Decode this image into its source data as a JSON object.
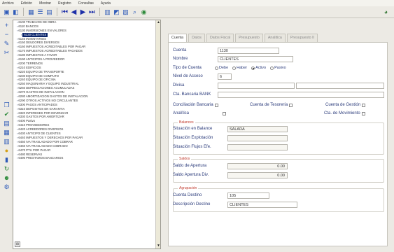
{
  "menu": [
    "Archivo",
    "Edición",
    "Mostrar",
    "Registro",
    "Consultas",
    "Ayuda"
  ],
  "toolbar": {
    "icons": [
      "open-icon",
      "save-icon",
      "grid-icon",
      "list-icon",
      "table-icon",
      "first-record-icon",
      "prev-record-icon",
      "next-record-icon",
      "last-record-icon",
      "print-icon",
      "filter-icon",
      "preview-icon",
      "search-icon",
      "refresh-icon"
    ],
    "help_icon": "help-icon"
  },
  "left_icons": [
    "add-icon",
    "delete-icon",
    "edit-icon",
    "cut-icon",
    "copy-icon",
    "check-icon",
    "notes-icon",
    "calendar-icon",
    "report-icon",
    "money-icon",
    "chart-icon",
    "refresh-icon",
    "user-icon",
    "settings-icon"
  ],
  "tree": {
    "items": [
      {
        "level": 0,
        "text": "6100 TRABAJOS DE OBRA"
      },
      {
        "level": 0,
        "text": "6110 BANCOS"
      },
      {
        "level": 0,
        "text": "6130 INVERSIONES EN VALORES"
      },
      {
        "level": 1,
        "text": "6130 CLIENTES",
        "selected": true
      },
      {
        "level": 0,
        "text": "6140 INVENTARIOS"
      },
      {
        "level": 0,
        "text": "6150 DEUDORES DIVERSOS"
      },
      {
        "level": 0,
        "text": "6160 IMPUESTOS ACREDITABLES POR PAGAR"
      },
      {
        "level": 0,
        "text": "6170 IMPUESTOS ACREDITABLES PAGADOS"
      },
      {
        "level": 0,
        "text": "6180 IMPUESTOS A FAVOR"
      },
      {
        "level": 0,
        "text": "6190 ANTICIPOS A PROVEEDOR"
      },
      {
        "level": 0,
        "text": "6200 TERRENOS"
      },
      {
        "level": 0,
        "text": "6210 EDIFICIOS"
      },
      {
        "level": 0,
        "text": "6220 EQUIPO DE TRANSPORTE"
      },
      {
        "level": 0,
        "text": "6230 EQUIPO DE COMPUTO"
      },
      {
        "level": 0,
        "text": "6240 EQUIPO DE OFICINA"
      },
      {
        "level": 0,
        "text": "6250 MAQUINARIA Y EQUIPO INDUSTRIAL"
      },
      {
        "level": 0,
        "text": "6260 DEPRECIACIONES ACUMULADAS"
      },
      {
        "level": 0,
        "text": "6270 GASTOS DE INSTALACION"
      },
      {
        "level": 0,
        "text": "6280 AMORTIZACION GASTOS DE INSTALACION"
      },
      {
        "level": 0,
        "text": "6290 OTROS ACTIVOS NO CIRCULANTES"
      },
      {
        "level": 0,
        "text": "6300 PAGOS ANTICIPADOS"
      },
      {
        "level": 0,
        "text": "6310 DEPOSITOS EN GARANTIA"
      },
      {
        "level": 0,
        "text": "6320 INTERESES POR DEVENGAR"
      },
      {
        "level": 0,
        "text": "6330 GASTOS POR AMORTIZAR"
      },
      {
        "level": 0,
        "text": "6400 Pasivo"
      },
      {
        "level": 0,
        "text": "6410 PROVEEDORES"
      },
      {
        "level": 0,
        "text": "6420 ACREEDORES DIVERSOS"
      },
      {
        "level": 0,
        "text": "6430 ANTICIPO DE CLIENTES"
      },
      {
        "level": 0,
        "text": "6440 IMPUESTOS Y DERECHOS POR PAGAR"
      },
      {
        "level": 0,
        "text": "6450 IVA TRASLADADO POR COBRAR"
      },
      {
        "level": 0,
        "text": "6460 IVA TRASLADADO COBRADO"
      },
      {
        "level": 0,
        "text": "6470 PTU POR PAGAR"
      },
      {
        "level": 0,
        "text": "6480 RESERVAS"
      },
      {
        "level": 0,
        "text": "6490 PRESTAMOS BANCARIOS"
      }
    ]
  },
  "tabs": [
    "Cuenta",
    "Datos",
    "Datos Fiscal",
    "Presupuesto",
    "Analitica",
    "Presupuesto II"
  ],
  "form": {
    "cuenta_label": "Cuenta",
    "cuenta_value": "1130",
    "nombre_label": "Nombre",
    "nombre_value": "CLIENTES",
    "tipo_label": "Tipo de Cuenta",
    "tipo_options": [
      {
        "label": "Debe",
        "checked": false
      },
      {
        "label": "Haber",
        "checked": false
      },
      {
        "label": "Activo",
        "checked": true
      },
      {
        "label": "Pasivo",
        "checked": false
      }
    ],
    "nivel_label": "Nivel de Acceso",
    "nivel_value": "6",
    "divisa_label": "Divisa",
    "divisa_value": "",
    "cta_bancaria_label": "Cta. Bancaria BANK",
    "cta_bancaria_value": "",
    "conciliacion_label": "Conciliación Bancaria",
    "cuenta_tesoreria_label": "Cuenta de Tesorería",
    "cuenta_gestion_label": "Cuenta de Gestión",
    "analitica_label": "Analítica",
    "cta_movimiento_label": "Cta. de Movimiento",
    "group1_title": "Balances",
    "situacion_balance_label": "Situación en Balance",
    "situacion_balance_value": "SALADA",
    "situacion_explotacion_label": "Situación Explotación",
    "situacion_explotacion_value": "",
    "situacion_flujos_label": "Situación Flujos Efe.",
    "situacion_flujos_value": "",
    "group2_title": "Saldos",
    "saldo_apertura_label": "Saldo de Apertura",
    "saldo_apertura_value": "0.00",
    "saldo_apertura_div_label": "Saldo Apertura Div.",
    "saldo_apertura_div_value": "0.00",
    "group3_title": "Agrupación",
    "cuenta_destino_label": "Cuenta Destino",
    "cuenta_destino_value": "105",
    "descripcion_destino_label": "Descripción Destino",
    "descripcion_destino_value": "CLIENTES"
  }
}
